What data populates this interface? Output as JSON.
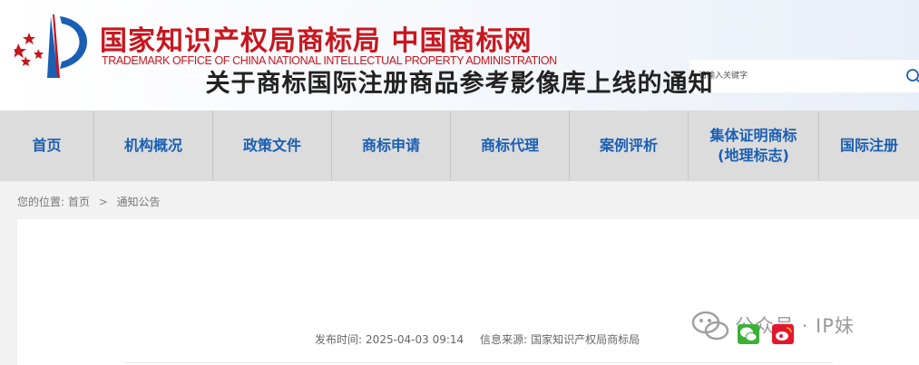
{
  "header": {
    "title_cn": "国家知识产权局商标局 中国商标网",
    "title_en": "TRADEMARK OFFICE OF CHINA NATIONAL INTELLECTUAL PROPERTY ADMINISTRATION",
    "brand_color": "#c8161d",
    "logo_icon": "cnipa-emblem-icon"
  },
  "search": {
    "placeholder": "请输入关键字",
    "icon": "search-icon"
  },
  "nav": {
    "items": [
      {
        "label": "首页"
      },
      {
        "label": "机构概况"
      },
      {
        "label": "政策文件"
      },
      {
        "label": "商标申请"
      },
      {
        "label": "商标代理"
      },
      {
        "label": "案例评析"
      },
      {
        "label": "集体证明商标\n(地理标志)"
      },
      {
        "label": "国际注册"
      }
    ],
    "link_color": "#1a5fb4"
  },
  "breadcrumb": {
    "prefix": "您的位置:",
    "home": "首页",
    "separator": ">",
    "current": "通知公告"
  },
  "article": {
    "title": "关于商标国际注册商品参考影像库上线的通知",
    "published_label": "发布时间:",
    "published_value": "2025-04-03 09:14",
    "source_label": "信息来源:",
    "source_value": "国家知识产权局商标局"
  },
  "watermark": {
    "text": "公众号 · IP妹",
    "icon": "wechat-official-account-icon"
  },
  "share": {
    "wechat_icon": "wechat-share-icon",
    "weibo_icon": "weibo-share-icon"
  }
}
